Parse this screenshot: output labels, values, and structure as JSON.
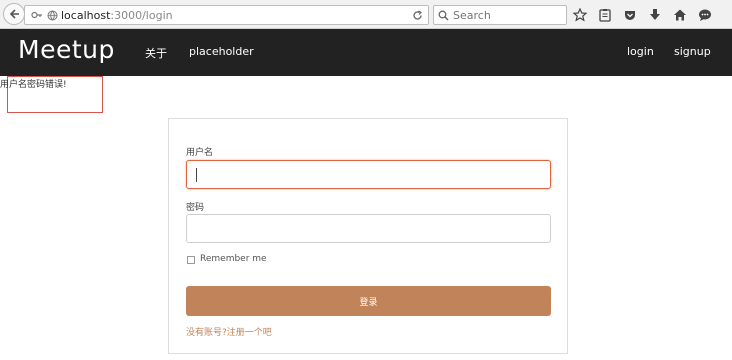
{
  "browser": {
    "url_host": "localhost",
    "url_path": ":3000/login",
    "search_placeholder": "Search"
  },
  "navbar": {
    "brand": "Meetup",
    "left_links": [
      "关于",
      "placeholder"
    ],
    "right_links": [
      "login",
      "signup"
    ]
  },
  "flash": {
    "message": "用户名密码错误!"
  },
  "form": {
    "username_label": "用户名",
    "username_value": "",
    "password_label": "密码",
    "password_value": "",
    "remember_label": "Remember me",
    "remember_checked": false,
    "submit_label": "登录",
    "signup_text": "没有账号?注册一个吧"
  },
  "colors": {
    "navbar_bg": "#222222",
    "accent": "#c1845a",
    "focus_border": "#e0643e",
    "error_border": "#d9534f"
  }
}
